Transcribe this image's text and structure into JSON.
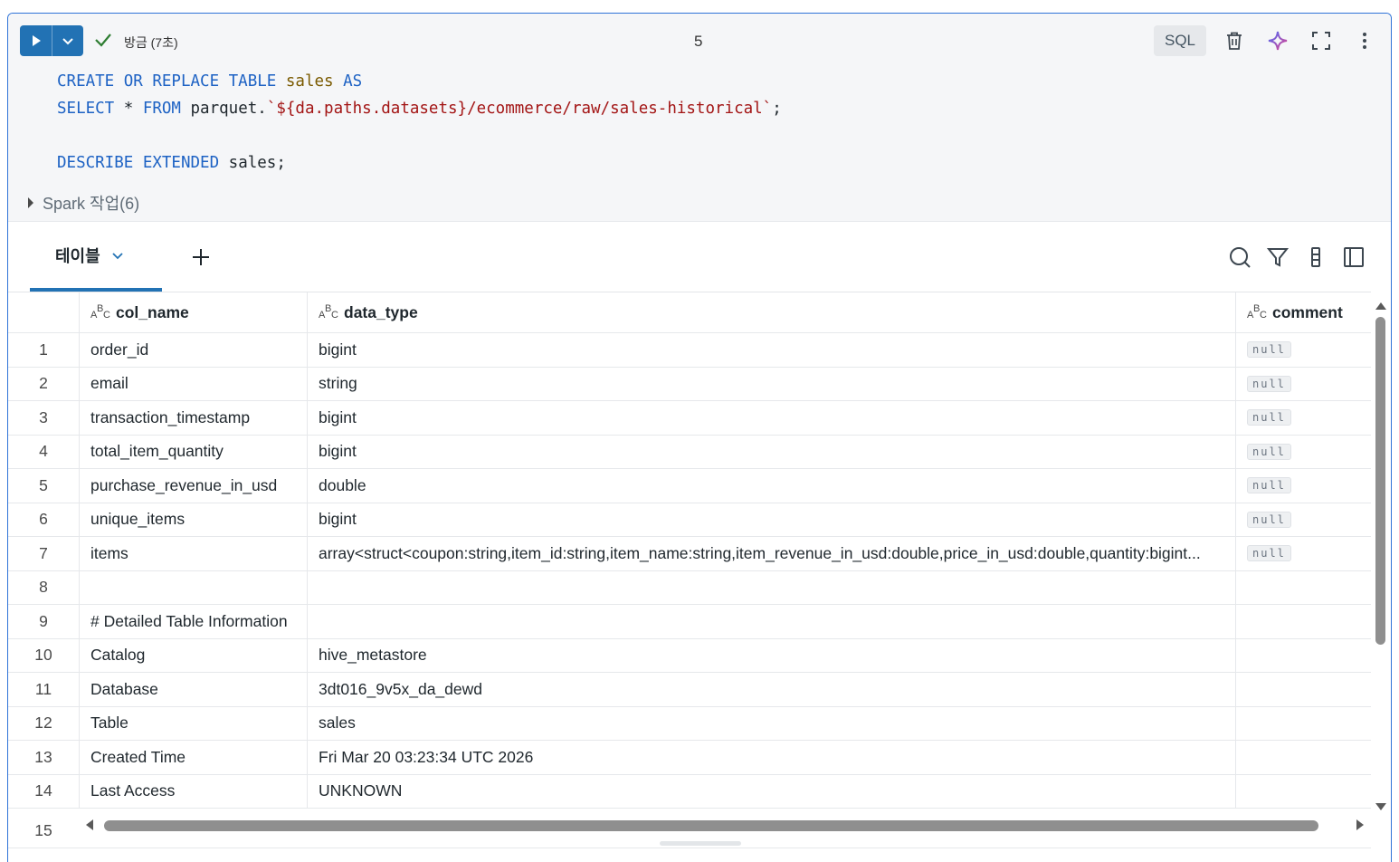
{
  "cell": {
    "status_text": "방금 (7초)",
    "cell_number": "5",
    "language": "SQL",
    "code_lines": [
      [
        {
          "t": "CREATE OR REPLACE TABLE ",
          "c": "kw"
        },
        {
          "t": "sales ",
          "c": "id"
        },
        {
          "t": "AS",
          "c": "kw"
        }
      ],
      [
        {
          "t": "SELECT",
          "c": "kw"
        },
        {
          "t": " * ",
          "c": ""
        },
        {
          "t": "FROM",
          "c": "kw"
        },
        {
          "t": " parquet.",
          "c": ""
        },
        {
          "t": "`${da.paths.datasets}/ecommerce/raw/sales-historical`",
          "c": "str"
        },
        {
          "t": ";",
          "c": ""
        }
      ],
      [],
      [
        {
          "t": "DESCRIBE EXTENDED",
          "c": "kw"
        },
        {
          "t": " sales;",
          "c": ""
        }
      ]
    ],
    "spark_jobs": "Spark 작업(6)"
  },
  "results": {
    "tab_label": "테이블",
    "columns": [
      "col_name",
      "data_type",
      "comment"
    ],
    "rows": [
      {
        "idx": "1",
        "col_name": "order_id",
        "data_type": "bigint",
        "comment": "null"
      },
      {
        "idx": "2",
        "col_name": "email",
        "data_type": "string",
        "comment": "null"
      },
      {
        "idx": "3",
        "col_name": "transaction_timestamp",
        "data_type": "bigint",
        "comment": "null"
      },
      {
        "idx": "4",
        "col_name": "total_item_quantity",
        "data_type": "bigint",
        "comment": "null"
      },
      {
        "idx": "5",
        "col_name": "purchase_revenue_in_usd",
        "data_type": "double",
        "comment": "null"
      },
      {
        "idx": "6",
        "col_name": "unique_items",
        "data_type": "bigint",
        "comment": "null"
      },
      {
        "idx": "7",
        "col_name": "items",
        "data_type": "array<struct<coupon:string,item_id:string,item_name:string,item_revenue_in_usd:double,price_in_usd:double,quantity:bigint...",
        "comment": "null"
      },
      {
        "idx": "8",
        "col_name": "",
        "data_type": "",
        "comment": ""
      },
      {
        "idx": "9",
        "col_name": "# Detailed Table Information",
        "data_type": "",
        "comment": ""
      },
      {
        "idx": "10",
        "col_name": "Catalog",
        "data_type": "hive_metastore",
        "comment": ""
      },
      {
        "idx": "11",
        "col_name": "Database",
        "data_type": "3dt016_9v5x_da_dewd",
        "comment": ""
      },
      {
        "idx": "12",
        "col_name": "Table",
        "data_type": "sales",
        "comment": ""
      },
      {
        "idx": "13",
        "col_name": "Created Time",
        "data_type": "Fri Mar 20 03:23:34 UTC 2026",
        "comment": ""
      },
      {
        "idx": "14",
        "col_name": "Last Access",
        "data_type": "UNKNOWN",
        "comment": ""
      }
    ],
    "partial_row_idx": "15"
  },
  "icons": {
    "run": "play-icon",
    "run_menu": "chevron-down-icon",
    "status": "check-icon",
    "delete": "trash-icon",
    "assistant": "sparkle-icon",
    "fullscreen": "expand-icon",
    "more": "more-vertical-icon",
    "search": "search-icon",
    "filter": "filter-icon",
    "columns": "column-settings-icon",
    "sidebar": "sidebar-panel-icon"
  },
  "colors": {
    "accent": "#2272b4",
    "cell_border": "#2f73d8",
    "keyword": "#1d62c4",
    "string": "#a31515",
    "identifier": "#7a5a00"
  }
}
